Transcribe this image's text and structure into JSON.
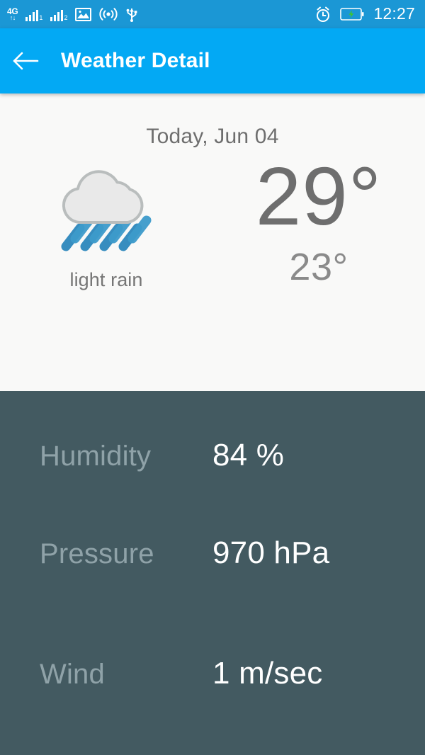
{
  "statusbar": {
    "network_label": "4G",
    "network_arrows": "↑↓",
    "sim1_label": "1",
    "sim2_label": "2",
    "icons": [
      "4g-data-icon",
      "signal-sim1-icon",
      "signal-sim2-icon",
      "gallery-image-icon",
      "hotspot-icon",
      "usb-icon",
      "alarm-icon",
      "battery-charging-icon"
    ],
    "clock": "12:27"
  },
  "toolbar": {
    "back_label": "back",
    "title": "Weather Detail"
  },
  "current": {
    "date": "Today, Jun 04",
    "condition": "light rain",
    "icon": "rain-cloud-icon",
    "temp_high": "29°",
    "temp_low": "23°"
  },
  "details": [
    {
      "label": "Humidity",
      "value": "84 %"
    },
    {
      "label": "Pressure",
      "value": "970 hPa"
    },
    {
      "label": "Wind",
      "value": "1 m/sec"
    }
  ],
  "colors": {
    "statusbar_blue": "#1b97d5",
    "toolbar_blue": "#03a9f4",
    "panel_light": "#f9f9f8",
    "panel_dark": "#435a61",
    "rain_blue": "#2d88bd",
    "cloud_gray": "#e8e8e8"
  }
}
